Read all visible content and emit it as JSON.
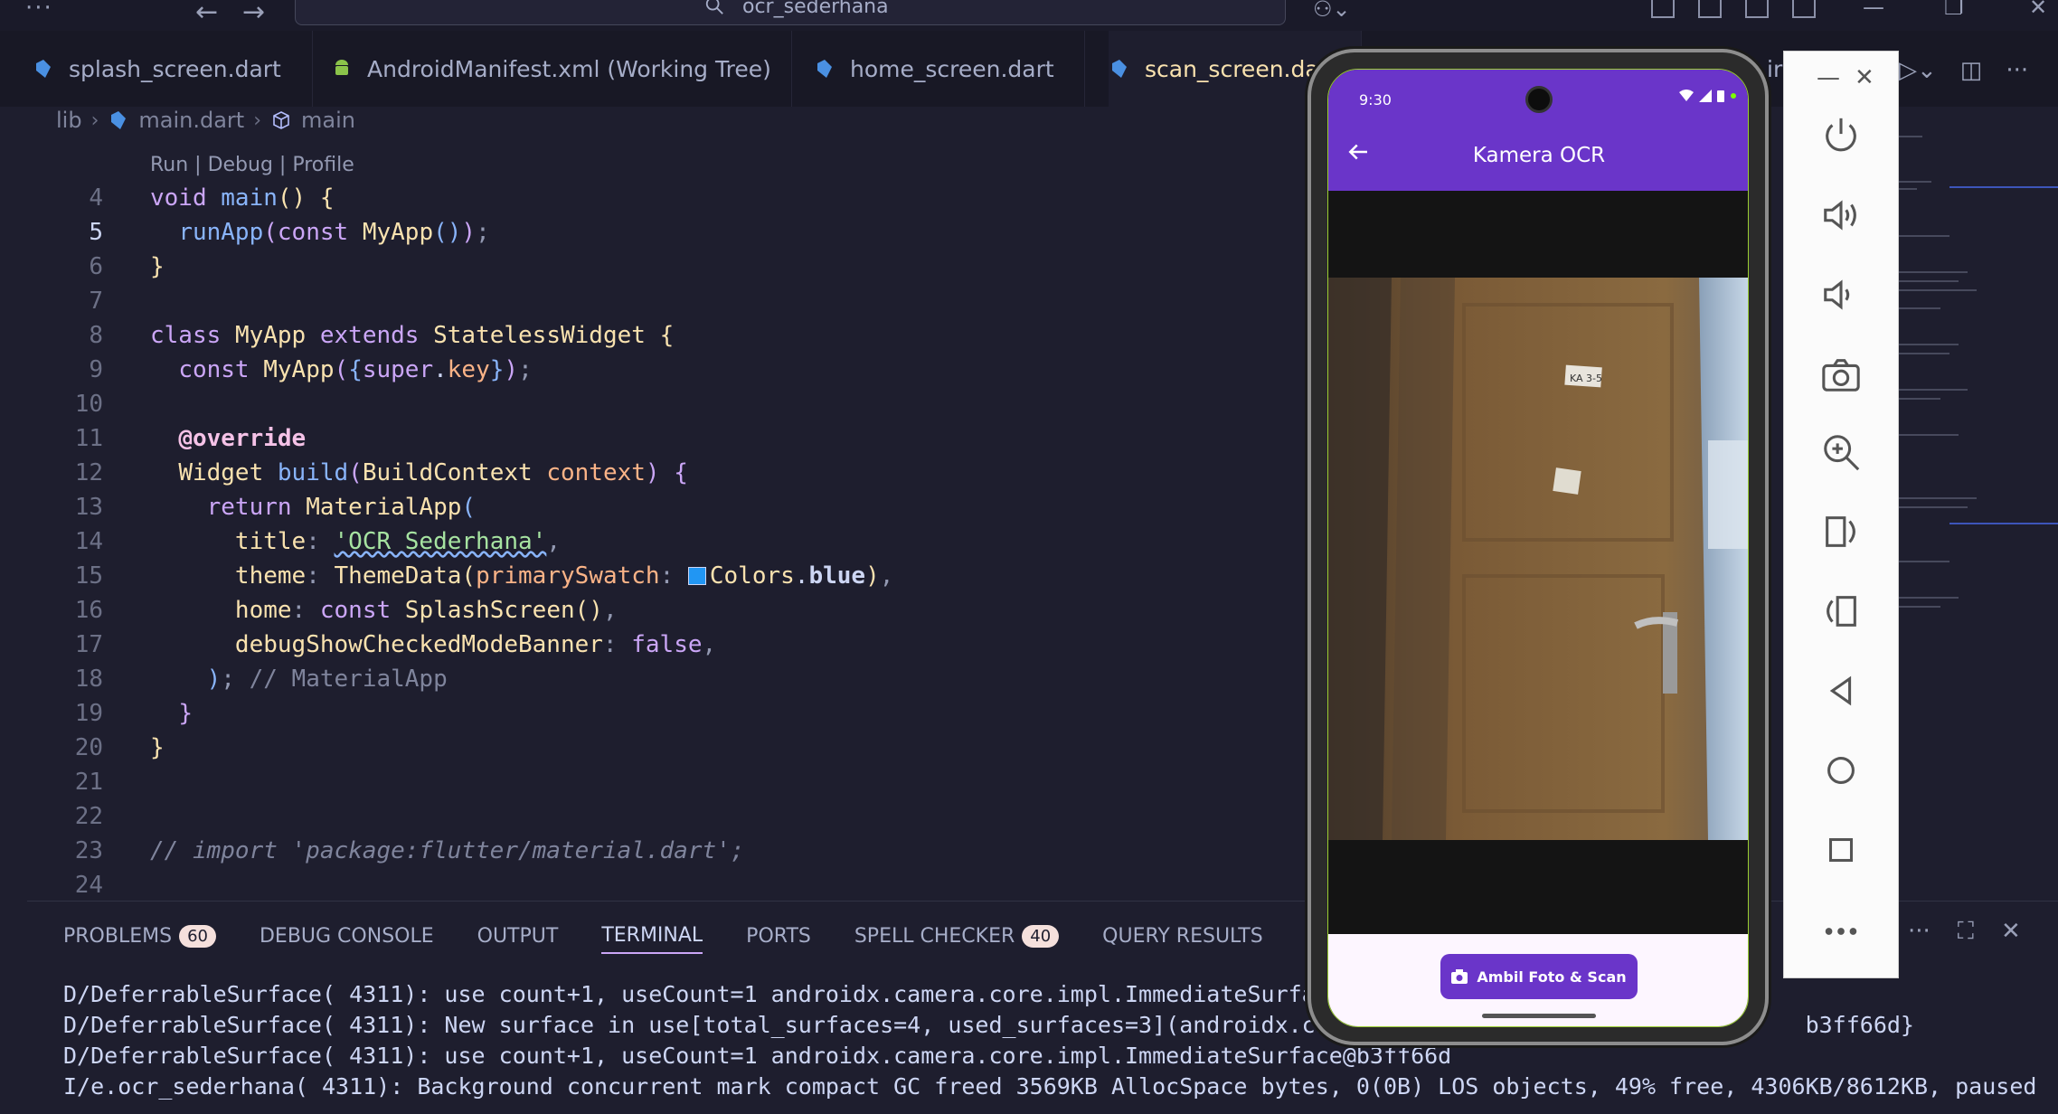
{
  "window": {
    "search_text": "ocr_sederhana"
  },
  "tabs": [
    {
      "label": "splash_screen.dart",
      "icon": "dart-file-icon"
    },
    {
      "label": "AndroidManifest.xml (Working Tree)",
      "icon": "android-icon"
    },
    {
      "label": "home_screen.dart",
      "icon": "dart-file-icon"
    },
    {
      "label": "scan_screen.dart",
      "icon": "dart-file-icon",
      "active": true
    },
    {
      "label": "ir",
      "icon": ""
    }
  ],
  "breadcrumb": {
    "folder": "lib",
    "file": "main.dart",
    "symbol": "main"
  },
  "codelens": "Run | Debug | Profile",
  "editor": {
    "current_line": 5,
    "line_numbers": [
      "4",
      "5",
      "6",
      "7",
      "8",
      "9",
      "10",
      "11",
      "12",
      "13",
      "14",
      "15",
      "16",
      "17",
      "18",
      "19",
      "20",
      "21",
      "22",
      "23",
      "24"
    ],
    "title_string": "'OCR Sederhana'",
    "comment_material_app": "// MaterialApp",
    "commented_import": "// import 'package:flutter/material.dart';"
  },
  "panel": {
    "tabs": [
      {
        "label": "PROBLEMS",
        "badge": "60"
      },
      {
        "label": "DEBUG CONSOLE"
      },
      {
        "label": "OUTPUT"
      },
      {
        "label": "TERMINAL",
        "active": true
      },
      {
        "label": "PORTS"
      },
      {
        "label": "SPELL CHECKER",
        "badge": "40"
      },
      {
        "label": "QUERY RESULTS"
      }
    ],
    "terminal_lines": [
      "D/DeferrableSurface( 4311): use count+1, useCount=1 androidx.camera.core.impl.ImmediateSurfa",
      "D/DeferrableSurface( 4311): New surface in use[total_surfaces=4, used_surfaces=3](androidx.ca                                   b3ff66d}",
      "D/DeferrableSurface( 4311): use count+1, useCount=1 androidx.camera.core.impl.ImmediateSurface@b3ff66d",
      "I/e.ocr_sederhana( 4311): Background concurrent mark compact GC freed 3569KB AllocSpace bytes, 0(0B) LOS objects, 49% free, 4306KB/8612KB, paused"
    ]
  },
  "phone": {
    "time": "9:30",
    "app_title": "Kamera OCR",
    "door_tag": "KA 3-5",
    "scan_button": "Ambil Foto & Scan",
    "accent": "#6a35c9"
  },
  "emulator_toolbar": [
    "power-icon",
    "volume-up-icon",
    "volume-down-icon",
    "camera-icon",
    "zoom-icon",
    "rotate-left-icon",
    "rotate-right-icon",
    "back-icon",
    "home-icon",
    "overview-icon",
    "more-icon"
  ]
}
